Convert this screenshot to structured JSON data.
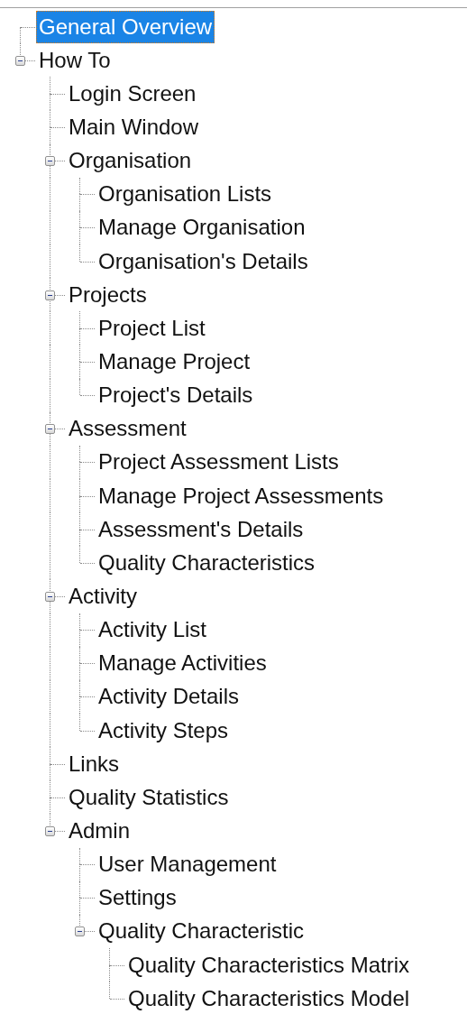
{
  "tree": {
    "items": [
      {
        "label": "General Overview",
        "selected": true
      },
      {
        "label": "How To",
        "selected": false,
        "expanded": true,
        "children": [
          {
            "label": "Login Screen",
            "selected": false
          },
          {
            "label": "Main Window",
            "selected": false
          },
          {
            "label": "Organisation",
            "selected": false,
            "expanded": true,
            "children": [
              {
                "label": "Organisation Lists",
                "selected": false
              },
              {
                "label": "Manage Organisation",
                "selected": false
              },
              {
                "label": "Organisation's Details",
                "selected": false
              }
            ]
          },
          {
            "label": "Projects",
            "selected": false,
            "expanded": true,
            "children": [
              {
                "label": "Project List",
                "selected": false
              },
              {
                "label": "Manage Project",
                "selected": false
              },
              {
                "label": "Project's Details",
                "selected": false
              }
            ]
          },
          {
            "label": "Assessment",
            "selected": false,
            "expanded": true,
            "children": [
              {
                "label": "Project Assessment Lists",
                "selected": false
              },
              {
                "label": "Manage Project Assessments",
                "selected": false
              },
              {
                "label": "Assessment's Details",
                "selected": false
              },
              {
                "label": "Quality Characteristics",
                "selected": false
              }
            ]
          },
          {
            "label": "Activity",
            "selected": false,
            "expanded": true,
            "children": [
              {
                "label": "Activity List",
                "selected": false
              },
              {
                "label": "Manage Activities",
                "selected": false
              },
              {
                "label": "Activity Details",
                "selected": false
              },
              {
                "label": "Activity Steps",
                "selected": false
              }
            ]
          },
          {
            "label": "Links",
            "selected": false
          },
          {
            "label": "Quality Statistics",
            "selected": false
          },
          {
            "label": "Admin",
            "selected": false,
            "expanded": true,
            "children": [
              {
                "label": "User Management",
                "selected": false
              },
              {
                "label": "Settings",
                "selected": false
              },
              {
                "label": "Quality Characteristic",
                "selected": false,
                "expanded": true,
                "children": [
                  {
                    "label": "Quality Characteristics Matrix",
                    "selected": false
                  },
                  {
                    "label": "Quality Characteristics Model",
                    "selected": false
                  }
                ]
              }
            ]
          }
        ]
      }
    ]
  }
}
